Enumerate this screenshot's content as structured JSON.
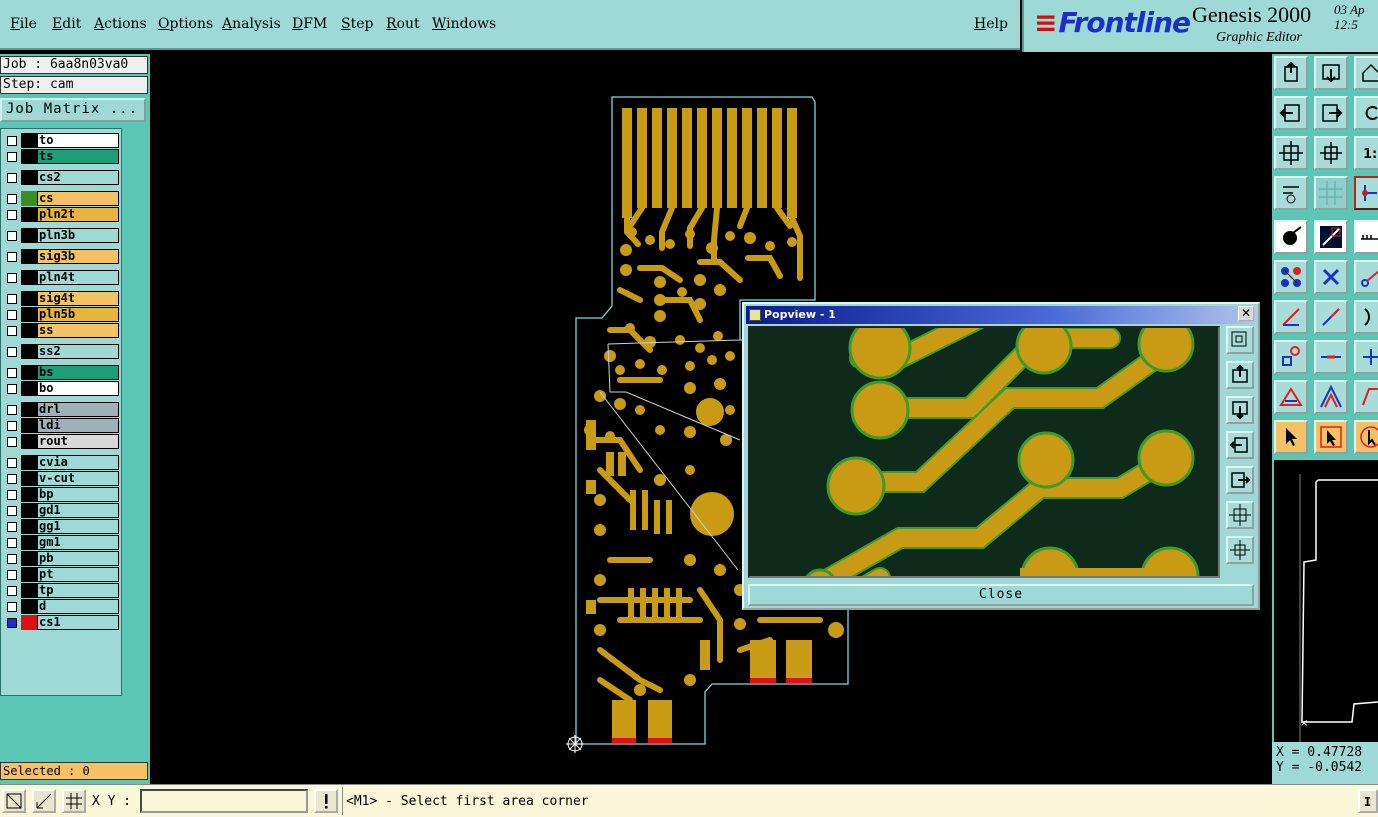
{
  "menu": {
    "items": [
      "File",
      "Edit",
      "Actions",
      "Options",
      "Analysis",
      "DFM",
      "Step",
      "Rout",
      "Windows"
    ],
    "help": "Help"
  },
  "brand": {
    "logo": "Frontline",
    "title": "Genesis 2000",
    "subtitle": "Graphic Editor",
    "date": "03 Ap\n12:5"
  },
  "job": {
    "job_line": "Job : 6aa8n03va0",
    "step_line": "Step: cam",
    "matrix_button": "Job Matrix ..."
  },
  "layers": [
    {
      "name": "to",
      "color": "#ffffff",
      "swatch": "#000000"
    },
    {
      "name": "ts",
      "color": "#1e9e78",
      "swatch": "#000000"
    },
    {
      "name": "cs2",
      "color": "#9fd9d6",
      "swatch": "#000000"
    },
    {
      "name": "cs",
      "color": "#f4c265",
      "swatch": "#3c8c28"
    },
    {
      "name": "pln2t",
      "color": "#e8b440",
      "swatch": "#000000"
    },
    {
      "name": "pln3b",
      "color": "#9fd9d6",
      "swatch": "#000000"
    },
    {
      "name": "sig3b",
      "color": "#f4c265",
      "swatch": "#000000"
    },
    {
      "name": "pln4t",
      "color": "#9fd9d6",
      "swatch": "#000000"
    },
    {
      "name": "sig4t",
      "color": "#f4c265",
      "swatch": "#000000"
    },
    {
      "name": "pln5b",
      "color": "#e8b440",
      "swatch": "#000000"
    },
    {
      "name": "ss",
      "color": "#f4c265",
      "swatch": "#000000"
    },
    {
      "name": "ss2",
      "color": "#9fd9d6",
      "swatch": "#000000"
    },
    {
      "name": "bs",
      "color": "#1e9e78",
      "swatch": "#000000"
    },
    {
      "name": "bo",
      "color": "#ffffff",
      "swatch": "#000000"
    },
    {
      "name": "drl",
      "color": "#a0b0b8",
      "swatch": "#000000"
    },
    {
      "name": "ldi",
      "color": "#a0b0b8",
      "swatch": "#000000"
    },
    {
      "name": "rout",
      "color": "#d8d8d8",
      "swatch": "#000000"
    },
    {
      "name": "cvia",
      "color": "#9fd9d6",
      "swatch": "#000000"
    },
    {
      "name": "v-cut",
      "color": "#9fd9d6",
      "swatch": "#000000"
    },
    {
      "name": "bp",
      "color": "#9fd9d6",
      "swatch": "#000000"
    },
    {
      "name": "gd1",
      "color": "#9fd9d6",
      "swatch": "#000000"
    },
    {
      "name": "gg1",
      "color": "#9fd9d6",
      "swatch": "#000000"
    },
    {
      "name": "gm1",
      "color": "#9fd9d6",
      "swatch": "#000000"
    },
    {
      "name": "pb",
      "color": "#9fd9d6",
      "swatch": "#000000"
    },
    {
      "name": "pt",
      "color": "#9fd9d6",
      "swatch": "#000000"
    },
    {
      "name": "tp",
      "color": "#9fd9d6",
      "swatch": "#000000"
    },
    {
      "name": "d",
      "color": "#9fd9d6",
      "swatch": "#000000"
    },
    {
      "name": "cs1",
      "color": "#9fd9d6",
      "swatch": "#e01010",
      "active": true
    }
  ],
  "selected": "Selected : 0",
  "coords": {
    "x": "X = 0.47728",
    "y": "Y = -0.0542"
  },
  "status": {
    "xy_label": "X Y :",
    "xy_value": "",
    "prompt": "<M1> - Select first area corner"
  },
  "popview": {
    "title": "Popview - 1",
    "close_label": "Close"
  },
  "colors": {
    "panel": "#9fd9d6",
    "panel_dark": "#5ac7b4",
    "copper": "#c99a14",
    "copper_edge": "#3c9a2a",
    "outline": "#7fd8e0"
  }
}
